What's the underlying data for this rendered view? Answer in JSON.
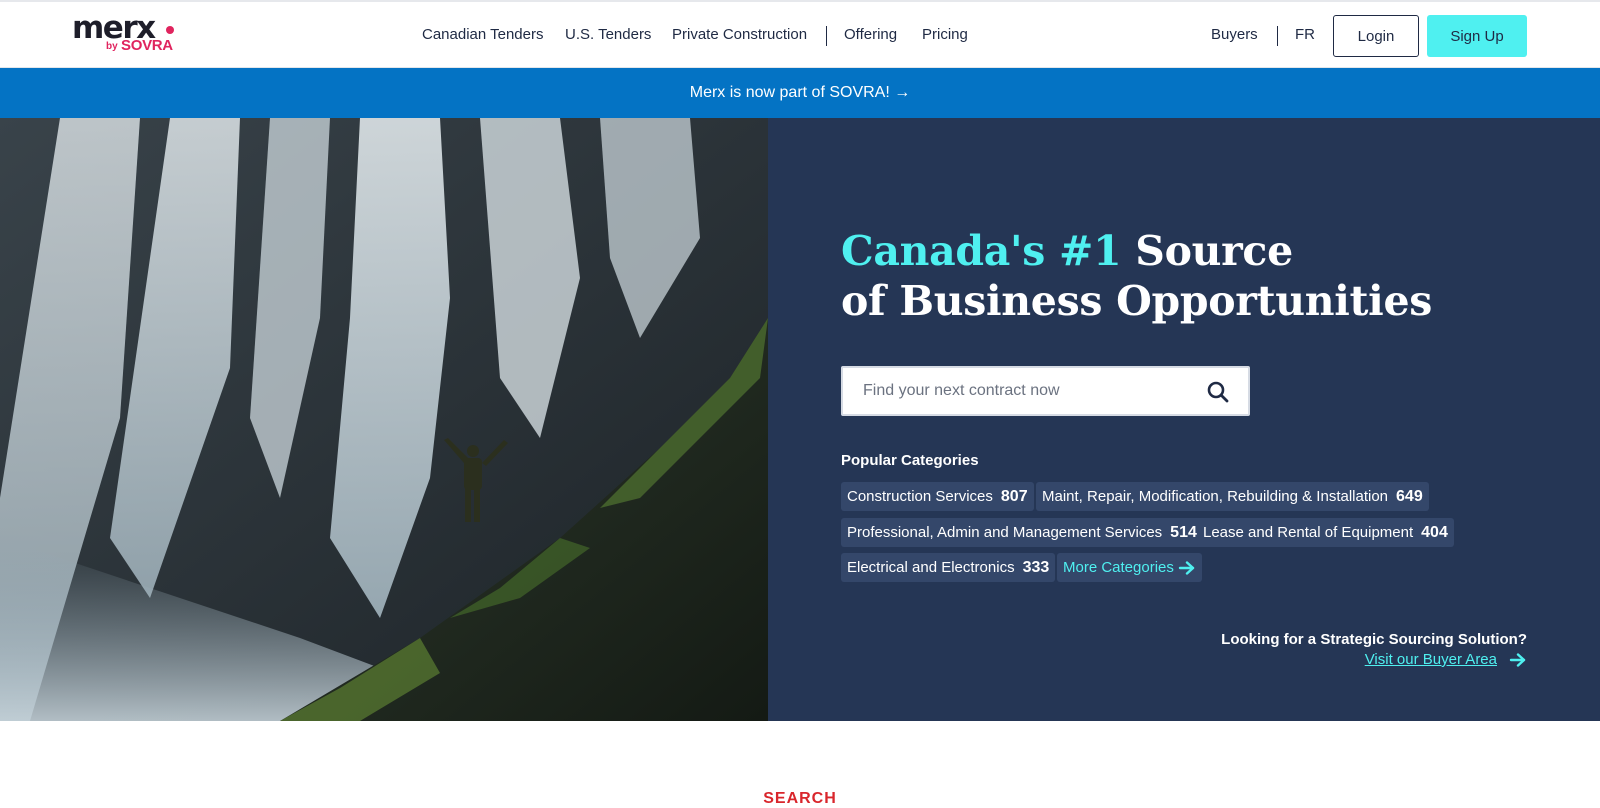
{
  "brand": {
    "logo_word": "merx",
    "logo_by": "by",
    "logo_sovra": "SOVRA"
  },
  "nav": {
    "items": [
      "Canadian Tenders",
      "U.S. Tenders",
      "Private Construction",
      "Offering",
      "Pricing"
    ],
    "buyers": "Buyers",
    "language": "FR",
    "login": "Login",
    "signup": "Sign Up"
  },
  "banner": {
    "text": "Merx is now part of SOVRA! →"
  },
  "hero": {
    "title_accent": "Canada's #1",
    "title_rest_line1": " Source",
    "title_line2": "of Business Opportunities",
    "search_placeholder": "Find your next contract now",
    "popular_heading": "Popular Categories",
    "categories": [
      {
        "label": "Construction Services",
        "count": "807"
      },
      {
        "label": "Maint, Repair, Modification, Rebuilding & Installation",
        "count": "649"
      },
      {
        "label": "Professional, Admin and Management Services",
        "count": "514"
      },
      {
        "label": "Lease and Rental of Equipment",
        "count": "404"
      },
      {
        "label": "Electrical and Electronics",
        "count": "333"
      }
    ],
    "more_categories": "More Categories",
    "buyer_question": "Looking for a Strategic Sourcing Solution?",
    "buyer_link": "Visit our Buyer Area"
  },
  "next_section_label": "SEARCH",
  "colors": {
    "accent_cyan": "#4ff0f0",
    "brand_pink": "#e0245e",
    "banner_blue": "#0473c4",
    "hero_navy": "#253655",
    "chip_bg": "#34476a"
  }
}
